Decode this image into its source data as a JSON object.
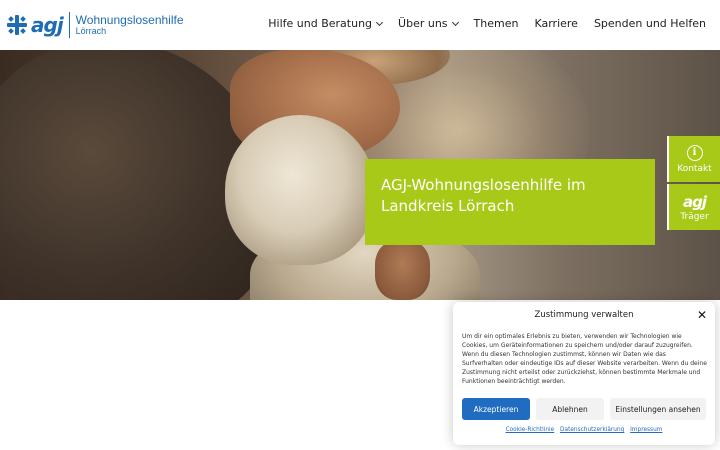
{
  "logo": {
    "mark": "agj",
    "title": "Wohnungslosenhilfe",
    "subtitle": "Lörrach",
    "brand_color": "#1f6cb4"
  },
  "nav": {
    "items": [
      {
        "label": "Hilfe und Beratung",
        "has_dropdown": true
      },
      {
        "label": "Über uns",
        "has_dropdown": true
      },
      {
        "label": "Themen",
        "has_dropdown": false
      },
      {
        "label": "Karriere",
        "has_dropdown": false
      },
      {
        "label": "Spenden und Helfen",
        "has_dropdown": false
      }
    ]
  },
  "hero": {
    "title": "AGJ-Wohnungslosenhilfe im Landkreis Lörrach",
    "accent_color": "#a9c918"
  },
  "side_tabs": [
    {
      "label": "Kontakt",
      "icon": "info-icon"
    },
    {
      "label": "Träger",
      "icon": "agj-logo-icon",
      "icon_text": "agj"
    }
  ],
  "consent": {
    "title": "Zustimmung verwalten",
    "body": "Um dir ein optimales Erlebnis zu bieten, verwenden wir Technologien wie Cookies, um Geräteinformationen zu speichern und/oder darauf zuzugreifen. Wenn du diesen Technologien zustimmst, können wir Daten wie das Surfverhalten oder eindeutige IDs auf dieser Website verarbeiten. Wenn du deine Zustimmung nicht erteilst oder zurückziehst, können bestimmte Merkmale und Funktionen beeinträchtigt werden.",
    "accept_label": "Akzeptieren",
    "deny_label": "Ablehnen",
    "prefs_label": "Einstellungen ansehen",
    "links": [
      "Cookie-Richtlinie",
      "Datenschutzerklärung",
      "Impressum"
    ],
    "accept_color": "#1f6cc0"
  }
}
